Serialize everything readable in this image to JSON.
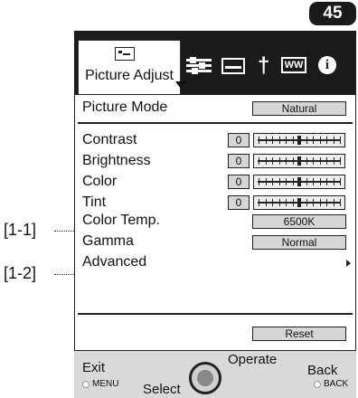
{
  "page_number": "45",
  "tab": {
    "active_label": "Picture Adjust"
  },
  "rows": {
    "picture_mode": {
      "label": "Picture Mode",
      "value": "Natural"
    },
    "contrast": {
      "label": "Contrast",
      "value": "0"
    },
    "brightness": {
      "label": "Brightness",
      "value": "0"
    },
    "color": {
      "label": "Color",
      "value": "0"
    },
    "tint": {
      "label": "Tint",
      "value": "0"
    },
    "color_temp": {
      "label": "Color Temp.",
      "value": "6500K"
    },
    "gamma": {
      "label": "Gamma",
      "value": "Normal"
    },
    "advanced": {
      "label": "Advanced"
    },
    "reset": {
      "label": "Reset"
    }
  },
  "footer": {
    "exit": "Exit",
    "menu": "MENU",
    "select": "Select",
    "operate": "Operate",
    "back": "Back",
    "back_key": "BACK"
  },
  "callouts": {
    "c1": "[1-1]",
    "c2": "[1-2]"
  },
  "icons": [
    "picture-adjust-icon",
    "sliders-icon",
    "screen-icon",
    "wrench-icon",
    "ww-icon",
    "info-icon"
  ]
}
